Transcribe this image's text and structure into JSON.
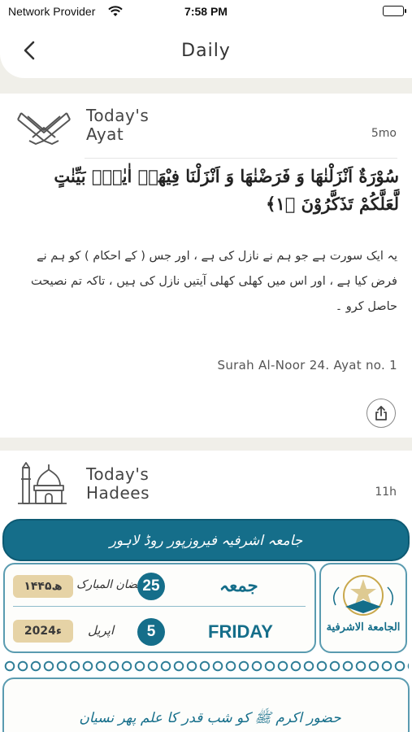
{
  "status_bar": {
    "carrier": "Network Provider",
    "time": "7:58 PM"
  },
  "header": {
    "title": "Daily"
  },
  "ayat": {
    "title_line1": "Today's",
    "title_line2": "Ayat",
    "time_ago": "5mo",
    "arabic": "سُوْرَةٌ اَنْزَلْنٰهَا وَ فَرَضْنٰهَا وَ اَنْزَلْنَا فِيْهَاۤ اٰيٰتٍۭ بَيِّنٰتٍ لَّعَلَّكُمْ تَذَكَّرُوْنَ ﴿۱﴾",
    "urdu": "یہ ایک سورت ہے جو ہم نے نازل کی ہے ، اور جس ( کے احکام ) کو ہم نے فرض کیا ہے ، اور اس میں کھلی کھلی آیتیں نازل کی ہیں ، تاکہ تم نصیحت حاصل کرو ۔",
    "reference": "Surah Al-Noor 24. Ayat no. 1"
  },
  "hadees": {
    "title_line1": "Today's",
    "title_line2": "Hadees",
    "time_ago": "11h",
    "banner_text": "جامعہ اشرفیہ فیروزپور روڈ لاہور",
    "hijri_day": "25",
    "hijri_month": "رمضان المبارک",
    "hijri_year": "۱۴۴۵ھ",
    "greg_day": "5",
    "greg_month": "اپریل",
    "greg_year": "2024ء",
    "weekday_urdu": "جمعہ",
    "weekday_en": "FRIDAY",
    "logo_text": "الجامعة الاشرفية",
    "hadees_text": "حضور اکرم ﷺ کو شب قدر کا علم پھر نسیان"
  },
  "colors": {
    "accent": "#156e8a",
    "gold": "#e6d3a6",
    "background": "#f0efe9"
  }
}
